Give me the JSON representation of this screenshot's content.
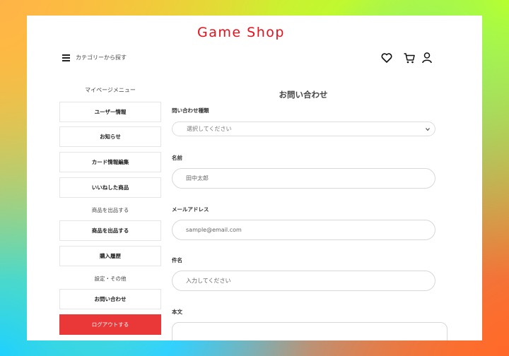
{
  "header": {
    "logo": "Game Shop",
    "category_link": "カテゴリーから探す",
    "icons": [
      "menu-icon",
      "heart-icon",
      "cart-icon",
      "user-icon"
    ]
  },
  "sidebar": {
    "title": "マイページメニュー",
    "items": [
      {
        "label": "ユーザー情報"
      },
      {
        "label": "お知らせ"
      },
      {
        "label": "カード情報編集"
      },
      {
        "label": "いいねした商品"
      }
    ],
    "section_sell": "商品を出品する",
    "sell_items": [
      {
        "label": "商品を出品する"
      },
      {
        "label": "購入履歴"
      }
    ],
    "section_settings": "設定・その他",
    "settings_items": [
      {
        "label": "お問い合わせ"
      }
    ],
    "logout": "ログアウトする"
  },
  "form": {
    "title": "お問い合わせ",
    "type_label": "問い合わせ種類",
    "type_selected": "選択してください",
    "name_label": "名前",
    "name_placeholder": "田中太郎",
    "email_label": "メールアドレス",
    "email_placeholder": "sample@email.com",
    "subject_label": "件名",
    "subject_placeholder": "入力してください",
    "body_label": "本文"
  },
  "colors": {
    "brand": "#e8101a",
    "logout": "#ea3838"
  }
}
